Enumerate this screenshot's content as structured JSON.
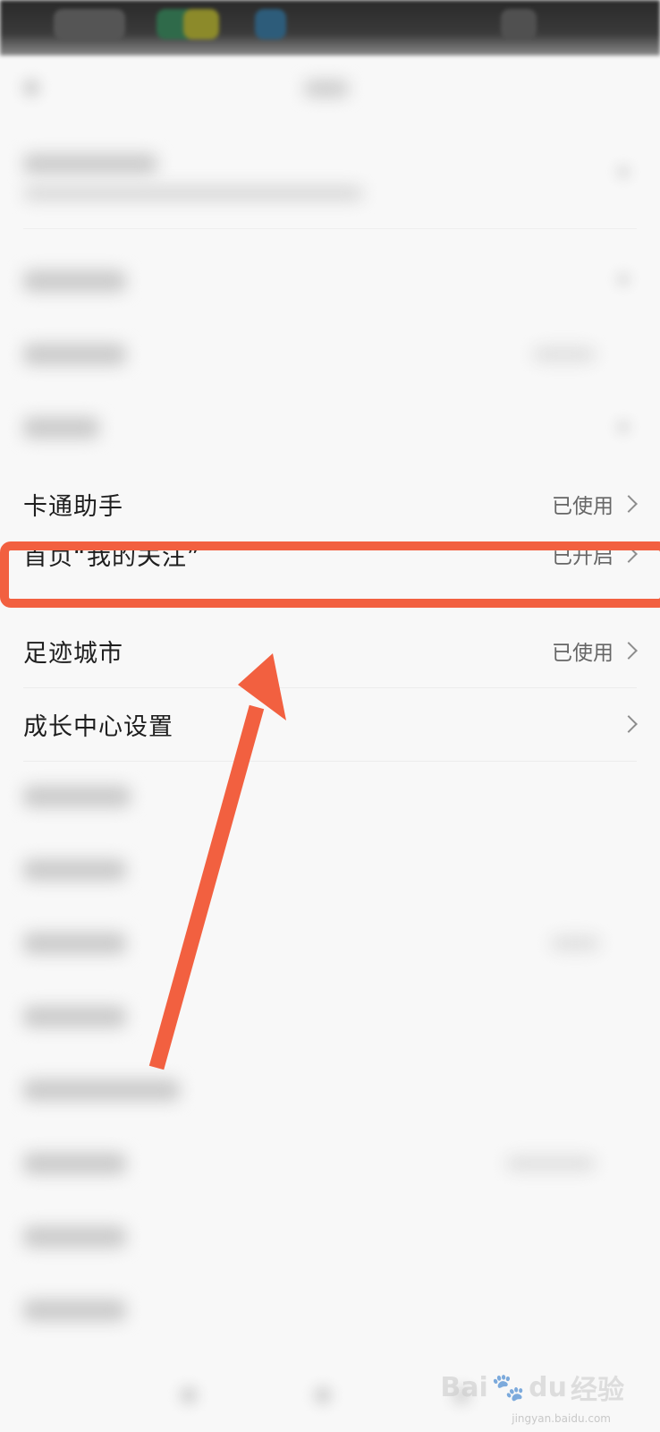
{
  "rows": [
    {
      "label": "卡通助手",
      "value": "已使用"
    },
    {
      "label": "首页“我的关注”",
      "value": "已开启"
    },
    {
      "label": "足迹城市",
      "value": "已使用"
    },
    {
      "label": "成长中心设置",
      "value": ""
    }
  ],
  "watermark": {
    "brand": "Bai",
    "suffix": "du",
    "cn": "经验",
    "url": "jingyan.baidu.com"
  },
  "colors": {
    "accent": "#f26040",
    "text": "#1f1f1f",
    "secondary": "#666666"
  }
}
